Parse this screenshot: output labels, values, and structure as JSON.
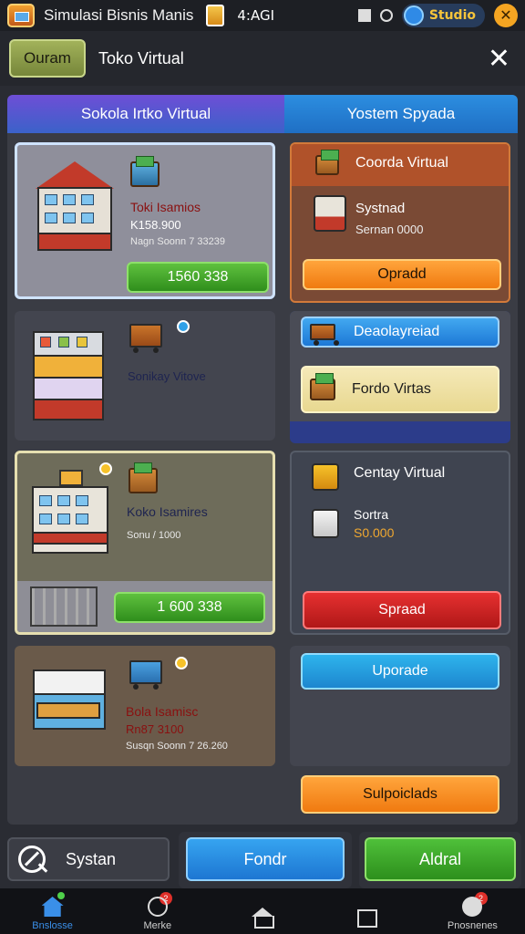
{
  "status_bar": {
    "app_title": "Simulasi Bisnis Manis",
    "clock": "4:AGI",
    "studio_label": "Studio"
  },
  "header": {
    "back_label": "Ouram",
    "title": "Toko Virtual"
  },
  "tabs": [
    {
      "label": "Sokola Irtko Virtual"
    },
    {
      "label": "Yostem Spyada"
    }
  ],
  "left_cards": [
    {
      "name": "Toki Isamios",
      "price": "K158.900",
      "detail": "Nagn Soonn 7 33239",
      "button": "1560 338"
    },
    {
      "name": "Sonikay Vitove"
    },
    {
      "name": "Koko Isamires",
      "detail": "Sonu / 1000",
      "button": "1 600 338"
    },
    {
      "name": "Bola Isamisc",
      "price": "Rn87 3100",
      "detail": "Susqn Soonn 7 26.260"
    }
  ],
  "right_cards": [
    {
      "title": "Coorda Virtual",
      "subtitle": "Systnad",
      "detail": "Sernan 0000",
      "button": "Opradd"
    },
    {
      "item1": "Deaolayreiad",
      "item2": "Fordo Virtas"
    },
    {
      "title": "Centay Virtual",
      "subtitle": "Sortra",
      "price": "S0.000",
      "button": "Spraad"
    },
    {
      "button": "Uporade"
    }
  ],
  "bottom_upgrade": "Sulpoiclads",
  "actions": {
    "system": "Systan",
    "primary": "Fondr",
    "secondary": "Aldral"
  },
  "nav": [
    {
      "label": "Bnslosse",
      "active": true
    },
    {
      "label": "Merke",
      "badge": "2"
    },
    {
      "label": ""
    },
    {
      "label": ""
    },
    {
      "label": "Pnosnenes",
      "badge": "2"
    }
  ],
  "colors": {
    "background": "#2a2c33",
    "accent_green": "#2f8e1c",
    "accent_orange": "#f07a10",
    "accent_red": "#b01818",
    "accent_blue": "#1d86cf"
  }
}
